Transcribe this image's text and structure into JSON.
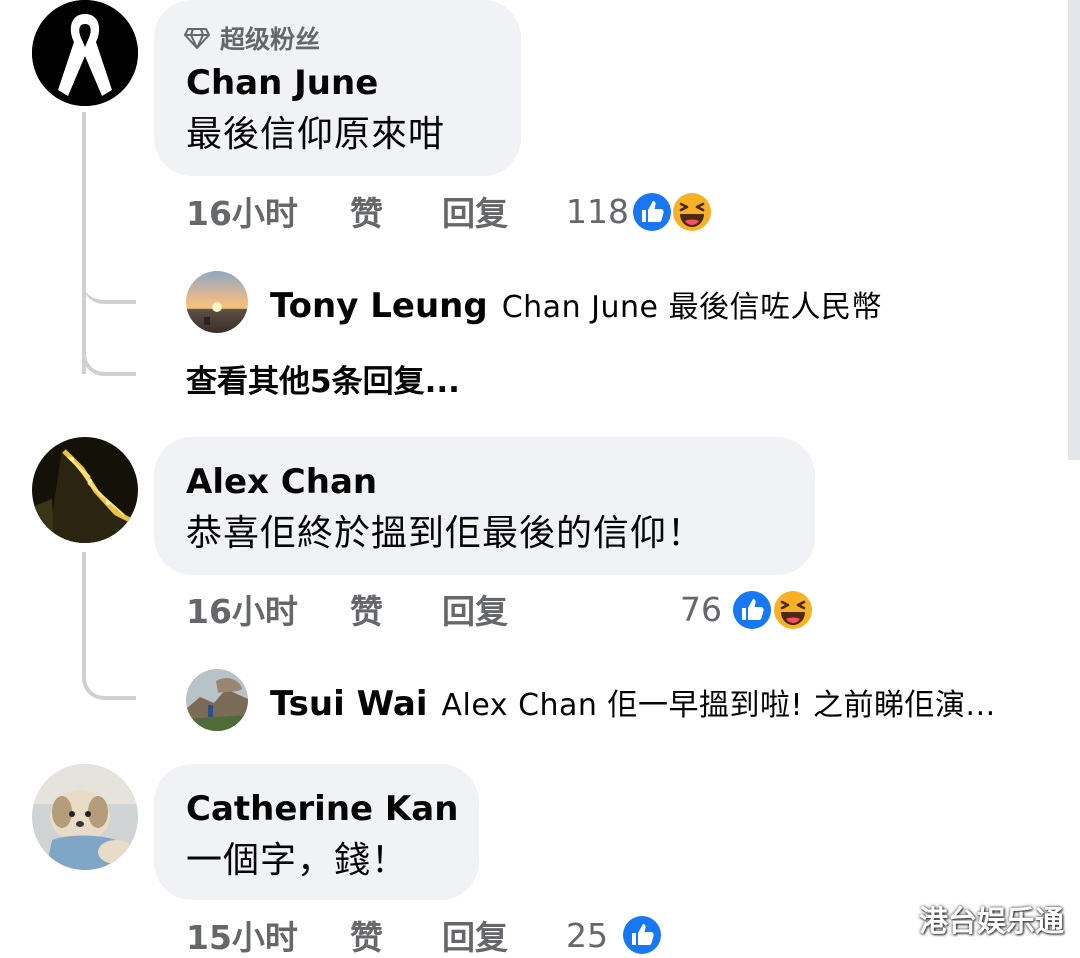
{
  "comments": [
    {
      "badge": "超级粉丝",
      "name": "Chan June",
      "text": "最後信仰原來咁",
      "time": "16小时",
      "like_label": "赞",
      "reply_label": "回复",
      "reaction_count": "118",
      "reactions": [
        "like-icon",
        "haha-icon"
      ],
      "reply": {
        "name": "Tony Leung",
        "text": "Chan June 最後信咗人民幣"
      },
      "more_replies": "查看其他5条回复..."
    },
    {
      "name": "Alex Chan",
      "text": "恭喜佢終於搵到佢最後的信仰！",
      "time": "16小时",
      "like_label": "赞",
      "reply_label": "回复",
      "reaction_count": "76",
      "reactions": [
        "like-icon",
        "haha-icon"
      ],
      "reply": {
        "name": "Tsui Wai",
        "text": "Alex Chan 佢一早搵到啦! 之前睇佢演..."
      }
    },
    {
      "name": "Catherine Kan",
      "text": "一個字，錢！",
      "time": "15小时",
      "like_label": "赞",
      "reply_label": "回复",
      "reaction_count": "25",
      "reactions": [
        "like-icon"
      ]
    }
  ],
  "watermark": "港台娱乐通",
  "colors": {
    "bubble": "#f0f2f5",
    "meta": "#65676b",
    "like_blue": "#1877f2",
    "haha_yellow": "#f7b125"
  }
}
